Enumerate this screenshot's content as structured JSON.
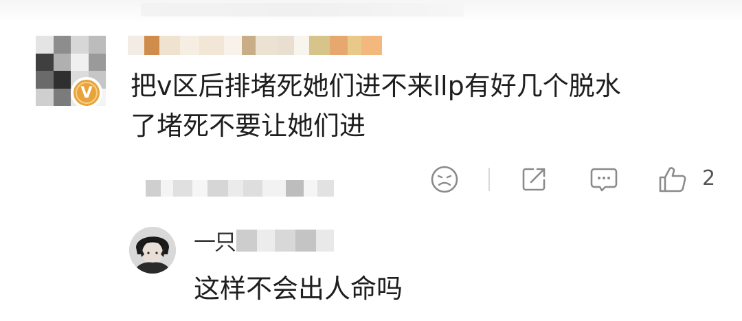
{
  "comment": {
    "badge_letter": "V",
    "text_lines": [
      "把v区后排堵死她们进不来llp有好几个脱水",
      "了堵死不要让她们进"
    ],
    "actions": {
      "dislike_icon": "sad-face-icon",
      "share_icon": "share-icon",
      "comment_icon": "comment-bubble-icon",
      "like_icon": "thumbs-up-icon",
      "like_count": "2"
    }
  },
  "reply": {
    "username_visible": "一只",
    "text": "这样不会出人命吗"
  },
  "colors": {
    "badge": "#e8a33a",
    "text": "#1e1e1e",
    "icon": "#8a8a8a"
  }
}
